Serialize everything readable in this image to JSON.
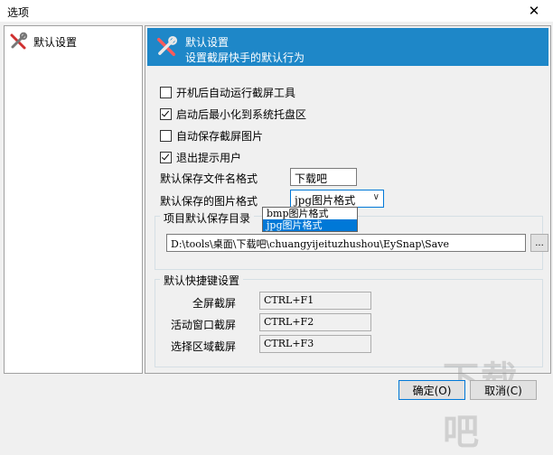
{
  "window": {
    "title": "选项",
    "close_glyph": "✕"
  },
  "sidebar": {
    "items": [
      {
        "label": "默认设置",
        "icon": "tools-icon"
      }
    ]
  },
  "banner": {
    "title": "默认设置",
    "subtitle": "设置截屏快手的默认行为",
    "icon": "tools-icon",
    "bg_color": "#1e87c8"
  },
  "options": [
    {
      "label": "开机后自动运行截屏工具",
      "checked": false
    },
    {
      "label": "启动后最小化到系统托盘区",
      "checked": true
    },
    {
      "label": "自动保存截屏图片",
      "checked": false
    },
    {
      "label": "退出提示用户",
      "checked": true
    }
  ],
  "filename_format": {
    "label": "默认保存文件名格式",
    "value": "下载吧"
  },
  "image_format": {
    "label": "默认保存的图片格式",
    "value": "jpg图片格式",
    "dropdown_open": true,
    "options": [
      "bmp图片格式",
      "jpg图片格式"
    ],
    "highlighted": "jpg图片格式"
  },
  "save_dir": {
    "group_title": "项目默认保存目录",
    "path": "D:\\tools\\桌面\\下载吧\\chuangyijeituzhushou\\EySnap\\Save",
    "browse_label": "..."
  },
  "hotkeys": {
    "group_title": "默认快捷键设置",
    "items": [
      {
        "label": "全屏截屏",
        "value": "CTRL+F1"
      },
      {
        "label": "活动窗口截屏",
        "value": "CTRL+F2"
      },
      {
        "label": "选择区域截屏",
        "value": "CTRL+F3"
      }
    ]
  },
  "buttons": {
    "ok": "确定(O)",
    "cancel": "取消(C)"
  },
  "watermark": "下载吧"
}
